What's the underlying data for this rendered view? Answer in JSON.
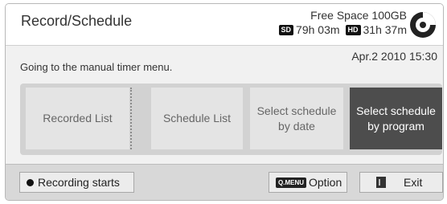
{
  "header": {
    "title": "Record/Schedule",
    "free_space": "Free Space 100GB",
    "sd_badge": "SD",
    "sd_time": "79h 03m",
    "hd_badge": "HD",
    "hd_time": "31h 37m",
    "disc_icon": "disc-usage-icon"
  },
  "main": {
    "datetime": "Apr.2 2010 15:30",
    "message": "Going to the manual timer menu.",
    "menu": [
      {
        "label_line1": "Recorded List",
        "label_line2": ""
      },
      {
        "label_line1": "Schedule List",
        "label_line2": ""
      },
      {
        "label_line1": "Select schedule",
        "label_line2": "by date"
      },
      {
        "label_line1": "Select schedule",
        "label_line2": "by program"
      }
    ],
    "selected_index": 3
  },
  "footer": {
    "record_label": "Recording starts",
    "option_key": "Q.MENU",
    "option_label": "Option",
    "exit_label": "Exit"
  },
  "colors": {
    "selected_bg": "#4d4d4d",
    "button_bg": "#e4e4e4",
    "panel_bg": "#d2d2d2"
  }
}
